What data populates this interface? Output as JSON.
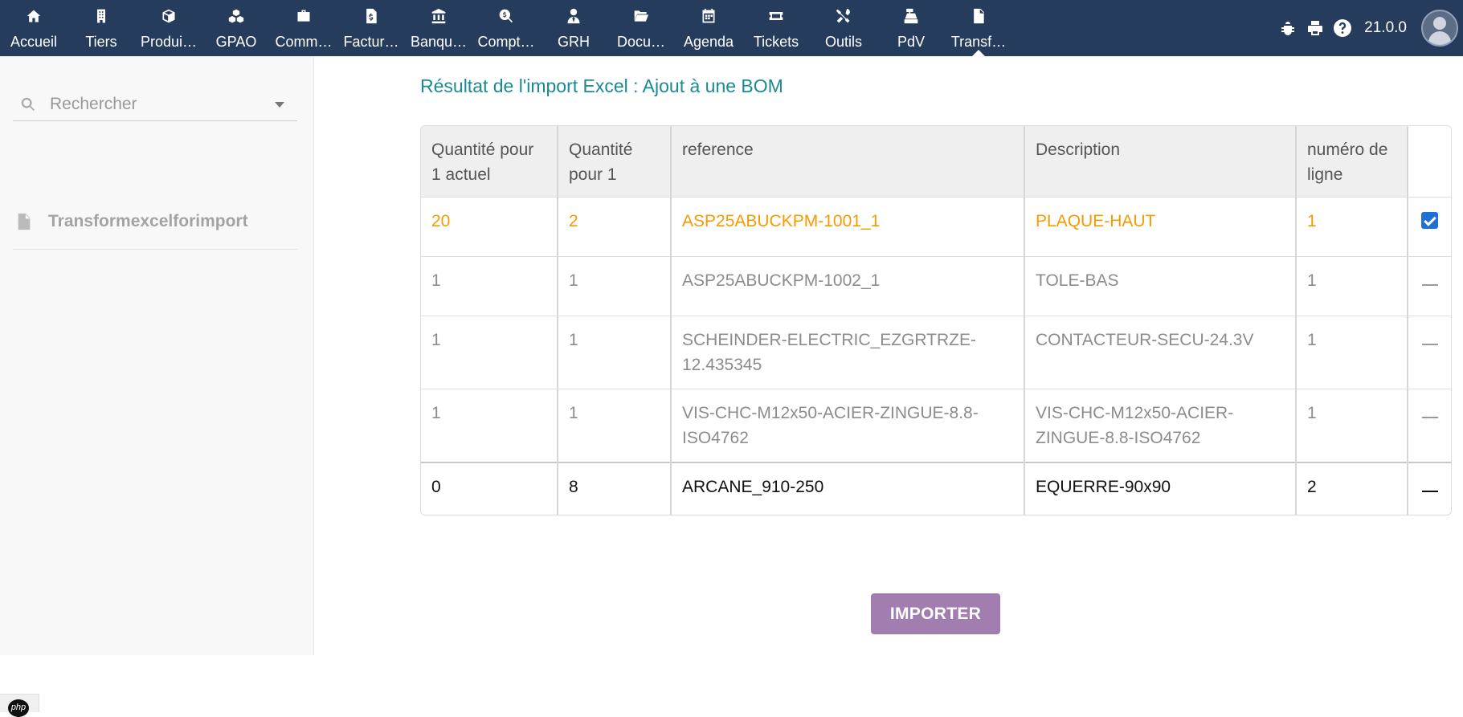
{
  "topbar": {
    "menu": [
      {
        "label": "Accueil",
        "icon": "home-icon"
      },
      {
        "label": "Tiers",
        "icon": "building-icon"
      },
      {
        "label": "Produits",
        "icon": "cube-icon"
      },
      {
        "label": "GPAO",
        "icon": "cubes-icon"
      },
      {
        "label": "Commerce",
        "icon": "briefcase-icon"
      },
      {
        "label": "Facturation",
        "icon": "invoice-icon"
      },
      {
        "label": "Banque",
        "icon": "bank-icon"
      },
      {
        "label": "Comptabilité",
        "icon": "search-dollar-icon"
      },
      {
        "label": "GRH",
        "icon": "user-tie-icon"
      },
      {
        "label": "Documents",
        "icon": "folder-open-icon"
      },
      {
        "label": "Agenda",
        "icon": "calendar-icon"
      },
      {
        "label": "Tickets",
        "icon": "ticket-icon"
      },
      {
        "label": "Outils",
        "icon": "tools-icon"
      },
      {
        "label": "PdV",
        "icon": "cash-register-icon"
      },
      {
        "label": "Transformexcelforimport",
        "icon": "file-icon"
      }
    ],
    "menu_display": [
      "Accueil",
      "Tiers",
      "Produi…",
      "GPAO",
      "Comm…",
      "Factur…",
      "Banqu…",
      "Compt…",
      "GRH",
      "Docu…",
      "Agenda",
      "Tickets",
      "Outils",
      "PdV",
      "Transf…"
    ],
    "right_icons": [
      "bug-icon",
      "print-icon",
      "help-icon"
    ],
    "version": "21.0.0",
    "avatar": "user-avatar"
  },
  "sidebar": {
    "search_placeholder": "Rechercher",
    "item_label": "Transformexcelforimport"
  },
  "main": {
    "title": "Résultat de l'import Excel : Ajout à une BOM",
    "columns": [
      "Quantité pour 1 actuel",
      "Quantité pour 1",
      "reference",
      "Description",
      "numéro de ligne"
    ],
    "rows": [
      {
        "qty_actual": "20",
        "qty": "2",
        "reference": "ASP25ABUCKPM-1001_1",
        "description": "PLAQUE-HAUT",
        "line": "1",
        "checked": true
      },
      {
        "qty_actual": "1",
        "qty": "1",
        "reference": "ASP25ABUCKPM-1002_1",
        "description": "TOLE-BAS",
        "line": "1",
        "checked": false
      },
      {
        "qty_actual": "1",
        "qty": "1",
        "reference": "SCHEINDER-ELECTRIC_EZGRTRZE-12.435345",
        "description": "CONTACTEUR-SECU-24.3V",
        "line": "1",
        "checked": false
      },
      {
        "qty_actual": "1",
        "qty": "1",
        "reference": "VIS-CHC-M12x50-ACIER-ZINGUE-8.8-ISO4762",
        "description": "VIS-CHC-M12x50-ACIER-ZINGUE-8.8-ISO4762",
        "line": "1",
        "checked": false
      },
      {
        "qty_actual": "0",
        "qty": "8",
        "reference": "ARCANE_910-250",
        "description": "EQUERRE-90x90",
        "line": "2",
        "checked": false
      }
    ],
    "import_button": "IMPORTER"
  },
  "colors": {
    "topbar_bg": "#263c5c",
    "title": "#1a8a95",
    "highlight_row": "#f59b00",
    "import_button": "#a27eb0",
    "checkbox": "#1f6fd8"
  }
}
